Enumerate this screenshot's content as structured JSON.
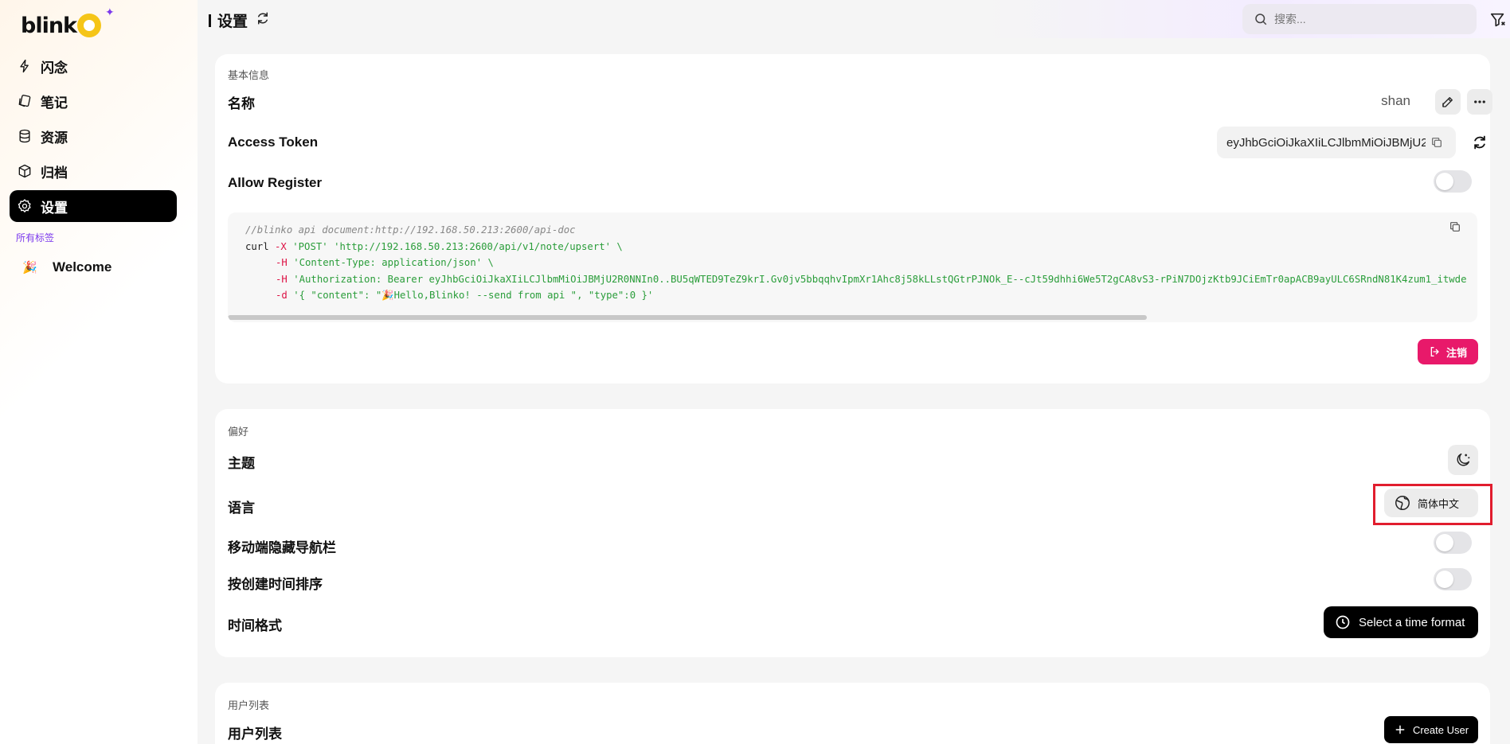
{
  "app": {
    "logo_text": "blink"
  },
  "sidebar": {
    "items": [
      {
        "label": "闪念",
        "icon": "flash-icon"
      },
      {
        "label": "笔记",
        "icon": "notes-icon"
      },
      {
        "label": "资源",
        "icon": "database-icon"
      },
      {
        "label": "归档",
        "icon": "archive-box-icon"
      },
      {
        "label": "设置",
        "icon": "gear-icon",
        "active": true
      }
    ],
    "tags_title": "所有标签",
    "tags": [
      {
        "emoji": "🎉",
        "label": "Welcome"
      }
    ]
  },
  "header": {
    "title": "设置",
    "search_placeholder": "搜索..."
  },
  "basic_info": {
    "section_label": "基本信息",
    "name_label": "名称",
    "name_value": "shan",
    "token_label": "Access Token",
    "token_value": "eyJhbGciOiJkaXIiLCJlbmMiOiJBMjU2R",
    "allow_register_label": "Allow Register",
    "allow_register_on": false,
    "code": {
      "comment": "//blinko api document:http://192.168.50.213:2600/api-doc",
      "line1_cmd": "curl ",
      "line1_flag": "-X ",
      "line1_rest": "'POST' 'http://192.168.50.213:2600/api/v1/note/upsert' \\",
      "line2_flag": "-H ",
      "line2_rest": "'Content-Type: application/json' \\",
      "line3_flag": "-H ",
      "line3_rest": "'Authorization: Bearer eyJhbGciOiJkaXIiLCJlbmMiOiJBMjU2R0NNIn0..BU5qWTED9TeZ9krI.Gv0jv5bbqqhvIpmXr1Ahc8j58kLLstQGtrPJNOk_E--cJt59dhhi6We5T2gCA8vS3-rPiN7DOjzKtb9JCiEmTr0apACB9ayULC6SRndN81K4zum1_itwde",
      "line4_flag": "-d ",
      "line4_rest": "'{ \"content\": \"🎉Hello,Blinko! --send from api \", \"type\":0 }'"
    },
    "logout_label": "注销"
  },
  "preferences": {
    "section_label": "偏好",
    "theme_label": "主题",
    "language_label": "语言",
    "language_value": "简体中文",
    "hide_nav_label": "移动端隐藏导航栏",
    "hide_nav_on": false,
    "sort_label": "按创建时间排序",
    "sort_on": false,
    "time_format_label": "时间格式",
    "time_format_button": "Select a time format"
  },
  "users": {
    "section_label": "用户列表",
    "title": "用户列表",
    "create_button": "Create User"
  },
  "colors": {
    "accent": "#7c3aed",
    "danger": "#e8196a",
    "logo_yellow": "#f5c518"
  }
}
